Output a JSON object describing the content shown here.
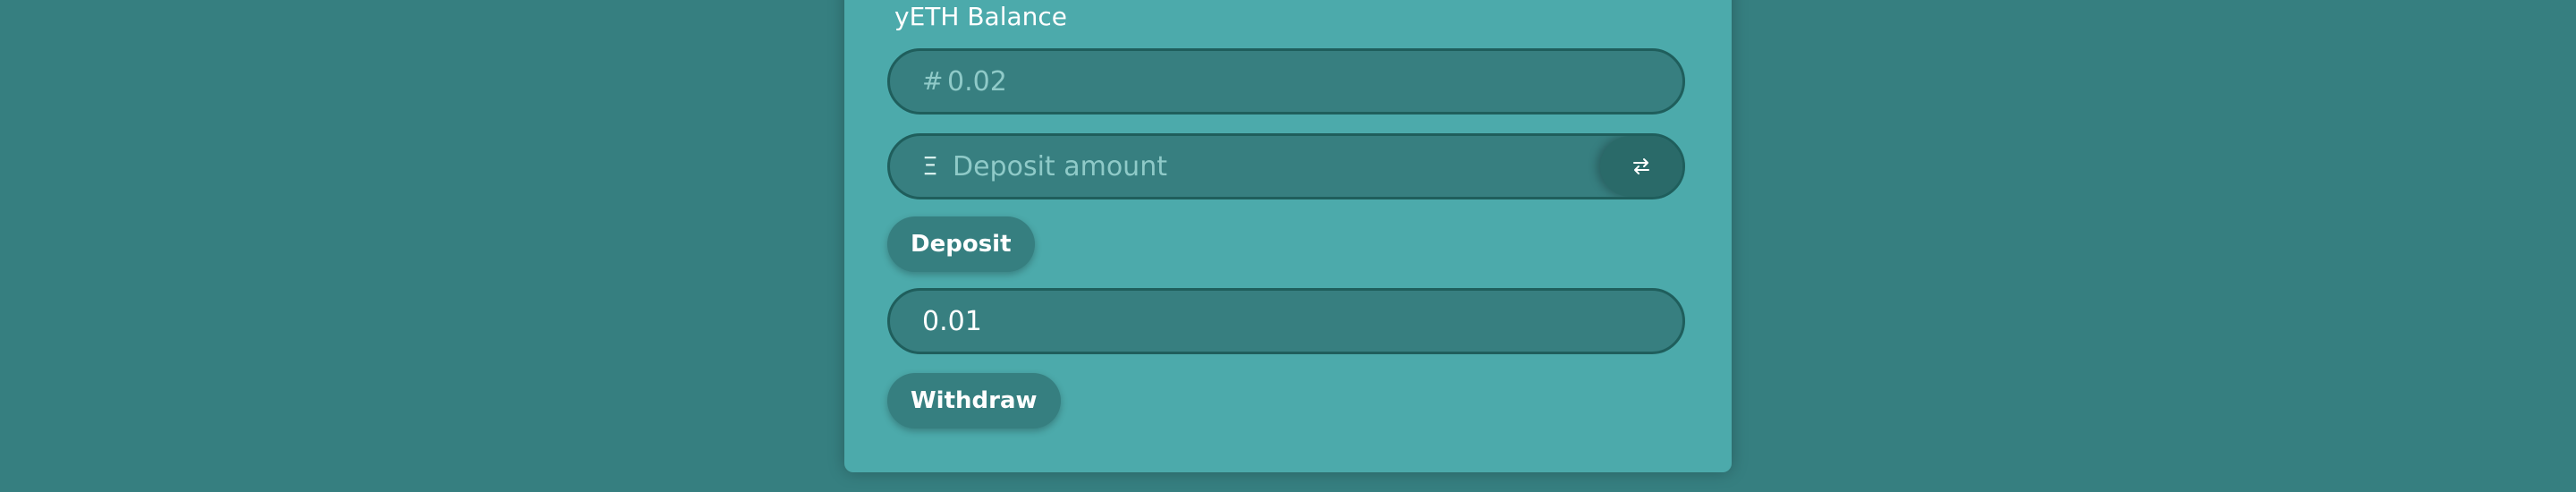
{
  "balance": {
    "label": "yETH Balance",
    "prefix": "#",
    "placeholder": "0.02"
  },
  "deposit": {
    "prefix": "Ξ",
    "placeholder": "Deposit amount",
    "swap_icon": "swap-arrows-icon",
    "button_label": "Deposit"
  },
  "withdraw": {
    "value": "0.01",
    "button_label": "Withdraw"
  },
  "colors": {
    "background": "#367f80",
    "card": "#4caaab",
    "field": "#377f80",
    "field_border": "#1f5e5c",
    "button": "#367f80"
  }
}
